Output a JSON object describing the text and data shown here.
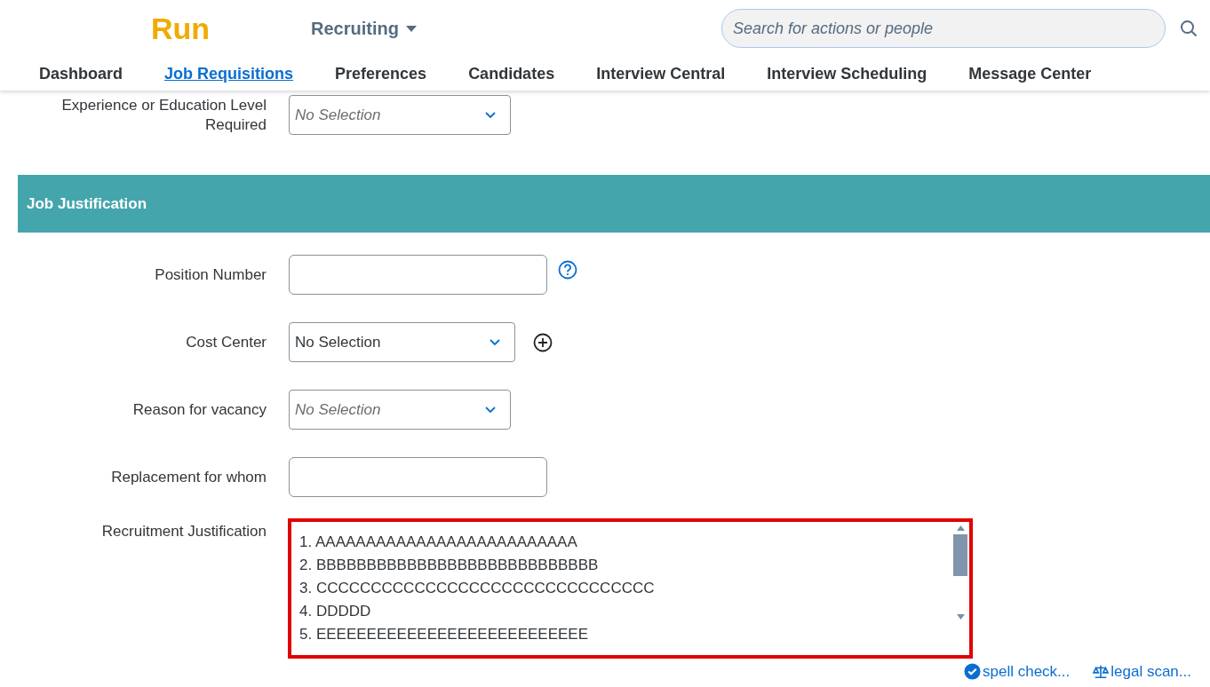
{
  "header": {
    "logo": "Run",
    "app_menu": "Recruiting",
    "search": {
      "placeholder": "Search for actions or people"
    }
  },
  "nav": [
    {
      "label": "Dashboard",
      "selected": false
    },
    {
      "label": "Job Requisitions",
      "selected": true
    },
    {
      "label": "Preferences",
      "selected": false
    },
    {
      "label": "Candidates",
      "selected": false
    },
    {
      "label": "Interview Central",
      "selected": false
    },
    {
      "label": "Interview Scheduling",
      "selected": false
    },
    {
      "label": "Message Center",
      "selected": false
    }
  ],
  "top_fields": [
    {
      "kind": "select",
      "label": "Experience or Education Level Required",
      "placeholder": "No Selection"
    }
  ],
  "section": {
    "title": "Job Justification"
  },
  "fields": [
    {
      "kind": "text",
      "label": "Position Number",
      "help": true
    },
    {
      "kind": "select",
      "label": "Cost Center",
      "value": "No Selection",
      "add": true
    },
    {
      "kind": "select",
      "label": "Reason for vacancy",
      "placeholder": "No Selection"
    },
    {
      "kind": "text",
      "label": "Replacement for whom"
    }
  ],
  "justification": {
    "label": "Recruitment Justification",
    "highlighted": true,
    "lines": [
      "1. AAAAAAAAAAAAAAAAAAAAAAAAAA",
      "2. BBBBBBBBBBBBBBBBBBBBBBBBBBBB",
      "3. CCCCCCCCCCCCCCCCCCCCCCCCCCCCCCC",
      "4. DDDDD",
      "5. EEEEEEEEEEEEEEEEEEEEEEEEEEE"
    ]
  },
  "actions": [
    {
      "kind": "spell",
      "label": "spell check..."
    },
    {
      "kind": "legal",
      "label": "legal scan..."
    }
  ]
}
